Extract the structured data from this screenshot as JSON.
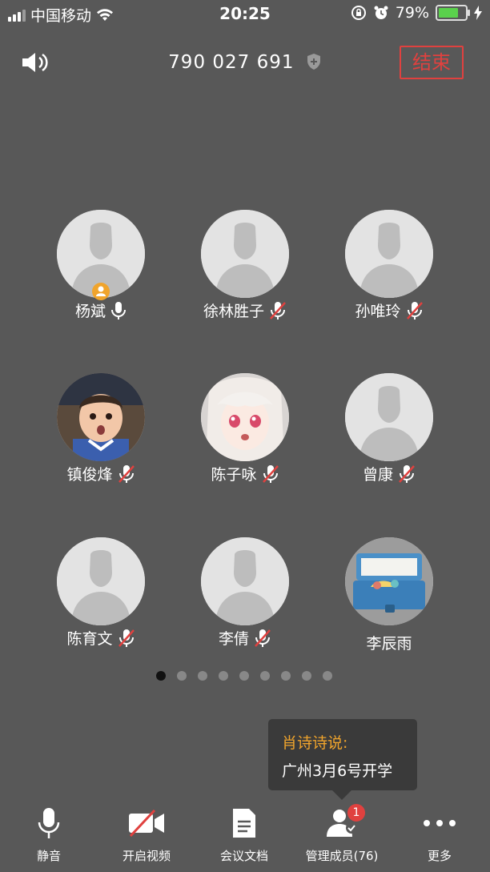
{
  "status_bar": {
    "carrier": "中国移动",
    "time": "20:25",
    "battery": "79%",
    "battery_level": 0.79
  },
  "header": {
    "meeting_id": "790 027 691",
    "end_label": "结束"
  },
  "participants": [
    {
      "name": "杨斌",
      "host": true,
      "mic": "on",
      "avatar": "default"
    },
    {
      "name": "徐林胜子",
      "host": false,
      "mic": "muted",
      "avatar": "default"
    },
    {
      "name": "孙唯玲",
      "host": false,
      "mic": "muted",
      "avatar": "default"
    },
    {
      "name": "镇俊烽",
      "host": false,
      "mic": "muted",
      "avatar": "photo-child"
    },
    {
      "name": "陈子咏",
      "host": false,
      "mic": "muted",
      "avatar": "photo-anime"
    },
    {
      "name": "曾康",
      "host": false,
      "mic": "muted",
      "avatar": "default"
    },
    {
      "name": "陈育文",
      "host": false,
      "mic": "muted",
      "avatar": "default"
    },
    {
      "name": "李倩",
      "host": false,
      "mic": "muted",
      "avatar": "default"
    },
    {
      "name": "李辰雨",
      "host": false,
      "mic": "none",
      "avatar": "photo-suitcase"
    }
  ],
  "pagination": {
    "pages": 9,
    "current": 1
  },
  "chat_tip": {
    "sender": "肖诗诗说:",
    "message": "广州3月6号开学"
  },
  "toolbar": {
    "mute": "静音",
    "video": "开启视频",
    "docs": "会议文档",
    "members": "管理成员(76)",
    "members_badge": "1",
    "more": "更多"
  },
  "colors": {
    "background": "#585858",
    "end_red": "#e0413f",
    "host_orange": "#f0a42c",
    "battery_green": "#5ad14c"
  }
}
